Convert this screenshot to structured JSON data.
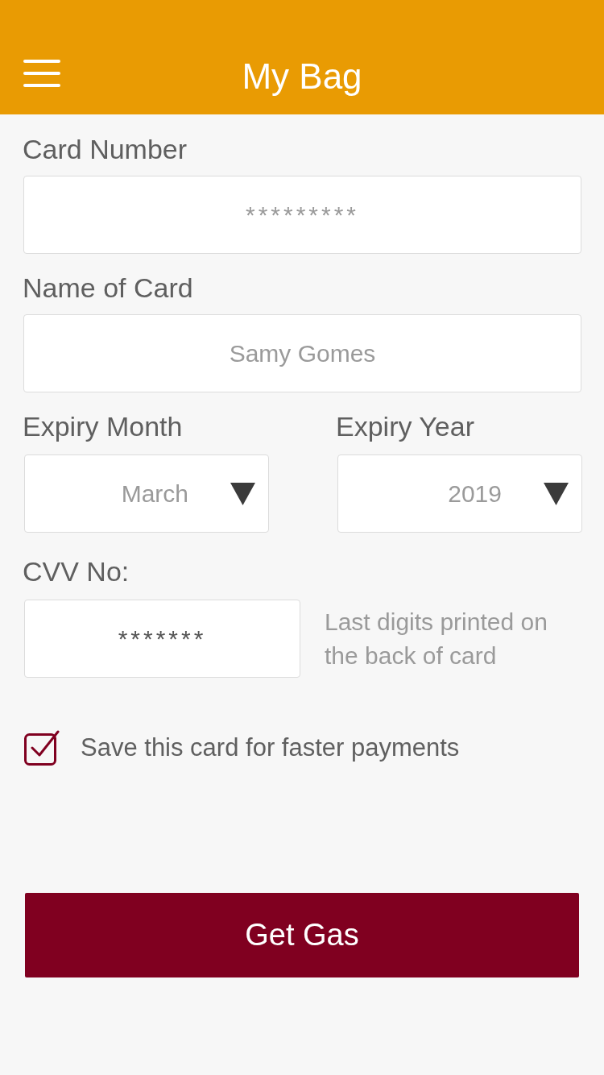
{
  "header": {
    "title": "My Bag"
  },
  "fields": [
    {
      "label": "Card Number",
      "placeholder": "*********"
    },
    {
      "label": "Name of Card",
      "placeholder": "Samy Gomes"
    }
  ],
  "expiry": [
    {
      "label": "Expiry Month",
      "value": "March"
    },
    {
      "label": "Expiry Year",
      "value": "2019"
    }
  ],
  "cvv": {
    "label": "CVV No:",
    "value": "*******",
    "hint": "Last digits printed on the back of card"
  },
  "save_card": {
    "label": "Save this card for faster payments",
    "checked": true
  },
  "button": {
    "label": "Get Gas"
  }
}
